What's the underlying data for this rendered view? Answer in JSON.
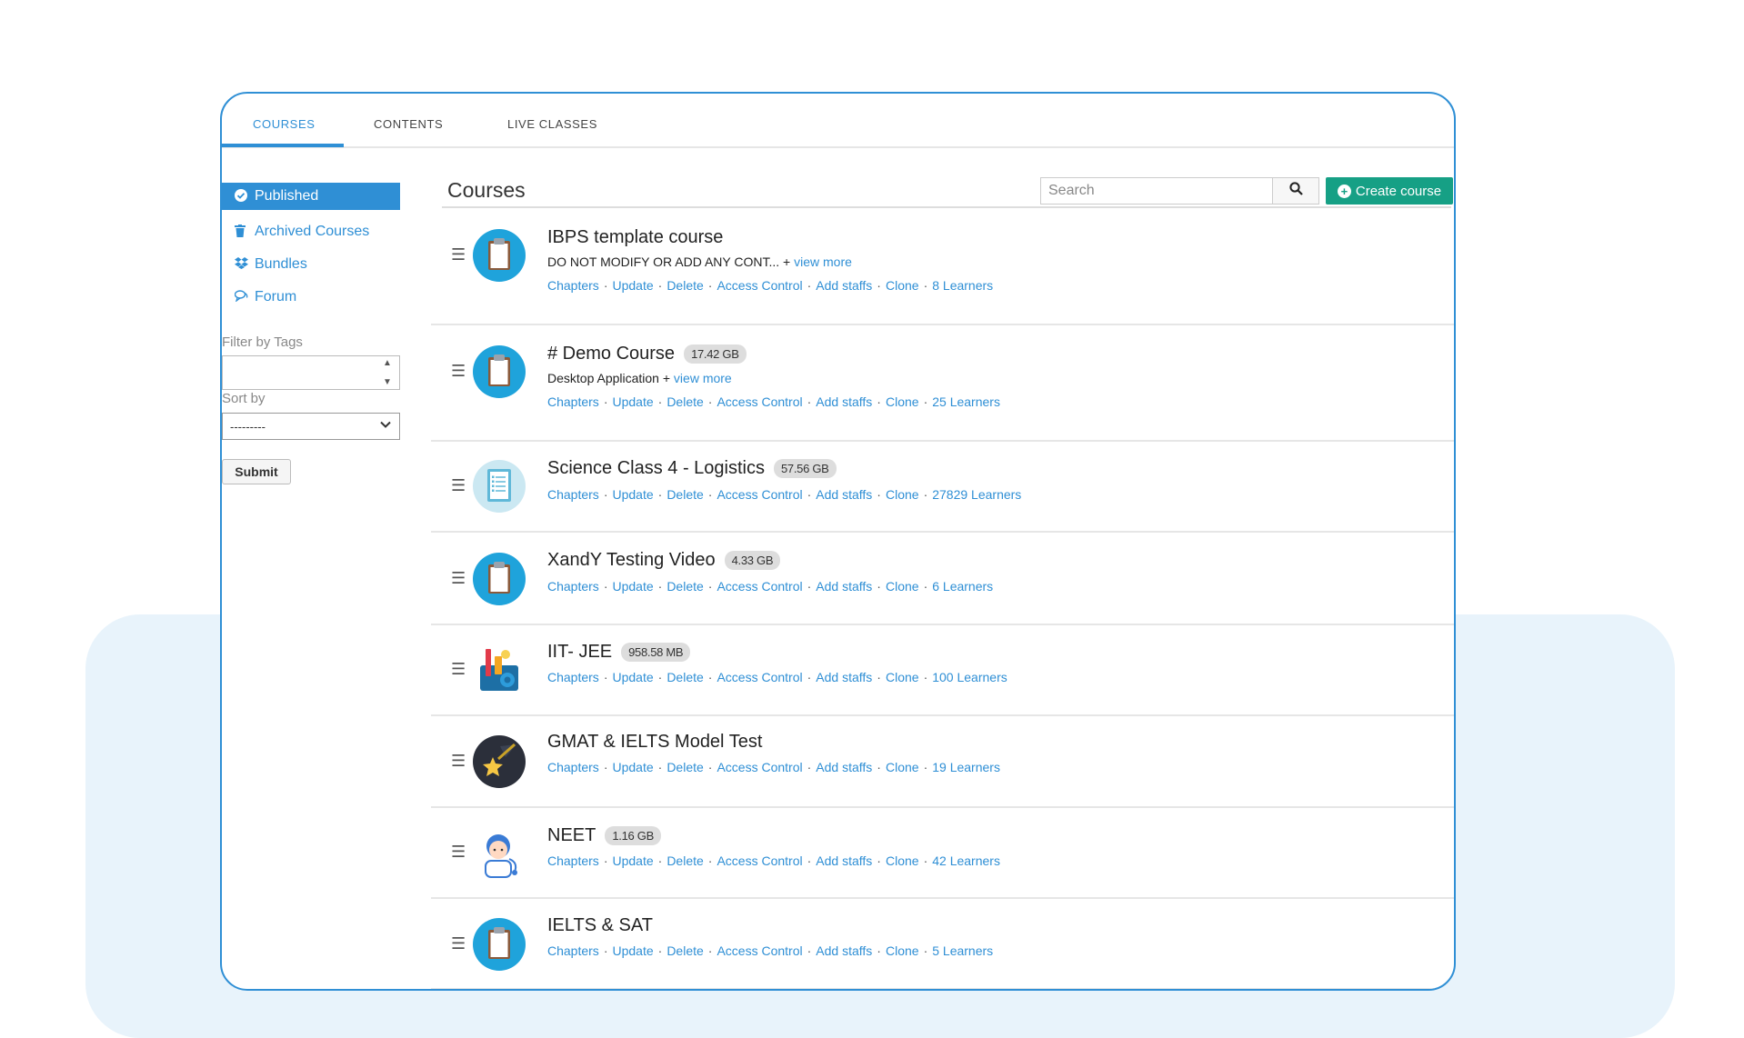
{
  "tabs": [
    {
      "label": "COURSES"
    },
    {
      "label": "CONTENTS"
    },
    {
      "label": "LIVE CLASSES"
    }
  ],
  "sidebar": {
    "items": [
      {
        "label": "Published",
        "icon": "check-circle-icon"
      },
      {
        "label": "Archived Courses",
        "icon": "trash-icon"
      },
      {
        "label": "Bundles",
        "icon": "dropbox-icon"
      },
      {
        "label": "Forum",
        "icon": "chat-icon"
      }
    ],
    "filter_label": "Filter by Tags",
    "sort_label": "Sort by",
    "sort_value": "---------",
    "submit_label": "Submit"
  },
  "main": {
    "title": "Courses",
    "search_placeholder": "Search",
    "create_label": "Create course"
  },
  "actions": [
    "Chapters",
    "Update",
    "Delete",
    "Access Control",
    "Add staffs",
    "Clone"
  ],
  "courses": [
    {
      "title": "IBPS template course",
      "size": "",
      "desc": "DO NOT MODIFY OR ADD ANY CONT... +",
      "view_more": "view more",
      "learners": "8 Learners",
      "icon": "clipboard-icon"
    },
    {
      "title": "# Demo Course",
      "size": "17.42 GB",
      "desc": "Desktop Application +",
      "view_more": "view more",
      "learners": "25 Learners",
      "icon": "clipboard-icon"
    },
    {
      "title": "Science Class 4 - Logistics",
      "size": "57.56 GB",
      "desc": "",
      "view_more": "",
      "learners": "27829 Learners",
      "icon": "checklist-icon"
    },
    {
      "title": "XandY Testing Video",
      "size": "4.33 GB",
      "desc": "",
      "view_more": "",
      "learners": "6 Learners",
      "icon": "clipboard-icon"
    },
    {
      "title": "IIT- JEE",
      "size": "958.58 MB",
      "desc": "",
      "view_more": "",
      "learners": "100 Learners",
      "icon": "science-kit-icon"
    },
    {
      "title": "GMAT & IELTS Model Test",
      "size": "",
      "desc": "",
      "view_more": "",
      "learners": "19 Learners",
      "icon": "shooting-star-icon"
    },
    {
      "title": "NEET",
      "size": "1.16 GB",
      "desc": "",
      "view_more": "",
      "learners": "42 Learners",
      "icon": "doctor-icon"
    },
    {
      "title": "IELTS & SAT",
      "size": "",
      "desc": "",
      "view_more": "",
      "learners": "5 Learners",
      "icon": "clipboard-icon"
    }
  ],
  "colors": {
    "accent": "#2f8fd5",
    "create": "#16a085"
  }
}
